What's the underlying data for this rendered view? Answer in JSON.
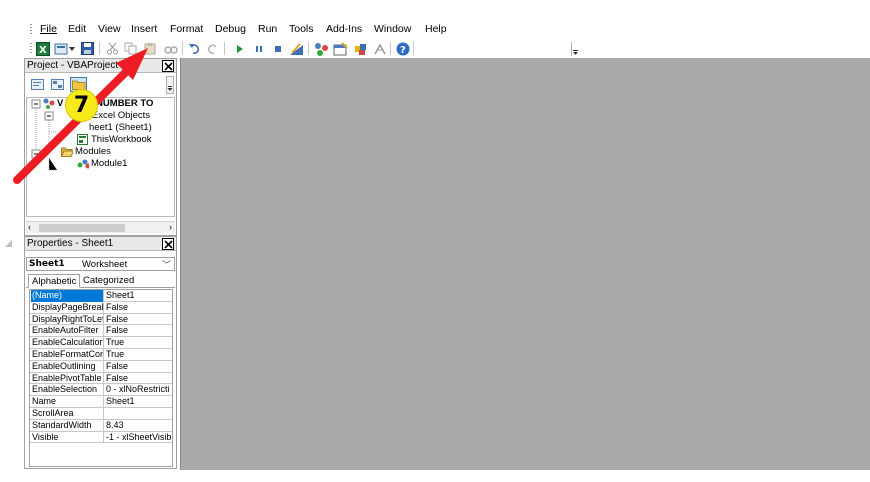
{
  "menubar": {
    "items": [
      "File",
      "Edit",
      "View",
      "Insert",
      "Format",
      "Debug",
      "Run",
      "Tools",
      "Add-Ins",
      "Window",
      "Help"
    ]
  },
  "toolbar": {
    "icons": [
      "excel-view-icon",
      "insert-object-icon",
      "save-icon",
      "cut-icon",
      "copy-icon",
      "paste-icon",
      "find-icon",
      "undo-icon",
      "redo-icon",
      "run-icon",
      "break-icon",
      "reset-icon",
      "design-mode-icon",
      "project-explorer-icon",
      "properties-icon",
      "object-browser-icon",
      "toolbox-icon",
      "help-icon"
    ]
  },
  "project_panel": {
    "title": "Project - VBAProject",
    "tree": [
      {
        "label": "VBAProject (NUMBER TO",
        "visible": "V     ect (NUMBER TO"
      },
      {
        "label": "Microsoft Excel Objects",
        "visible": "ft Excel Objects"
      },
      {
        "label": "Sheet1 (Sheet1)",
        "visible": "heet1 (Sheet1)"
      },
      {
        "label": "ThisWorkbook"
      },
      {
        "label": "Modules"
      },
      {
        "label": "Module1"
      }
    ]
  },
  "props_panel": {
    "title": "Properties - Sheet1",
    "object_name": "Sheet1",
    "object_type": "Worksheet",
    "tabs": [
      "Alphabetic",
      "Categorized"
    ],
    "rows": [
      {
        "k": "(Name)",
        "v": "Sheet1"
      },
      {
        "k": "DisplayPageBreak",
        "v": "False"
      },
      {
        "k": "DisplayRightToLef",
        "v": "False"
      },
      {
        "k": "EnableAutoFilter",
        "v": "False"
      },
      {
        "k": "EnableCalculation",
        "v": "True"
      },
      {
        "k": "EnableFormatCon",
        "v": "True"
      },
      {
        "k": "EnableOutlining",
        "v": "False"
      },
      {
        "k": "EnablePivotTable",
        "v": "False"
      },
      {
        "k": "EnableSelection",
        "v": "0 - xlNoRestricti"
      },
      {
        "k": "Name",
        "v": "Sheet1"
      },
      {
        "k": "ScrollArea",
        "v": ""
      },
      {
        "k": "StandardWidth",
        "v": "8.43"
      },
      {
        "k": "Visible",
        "v": "-1 - xlSheetVisib"
      }
    ]
  },
  "annotation": {
    "step": "7",
    "color": "#ee1c24"
  }
}
